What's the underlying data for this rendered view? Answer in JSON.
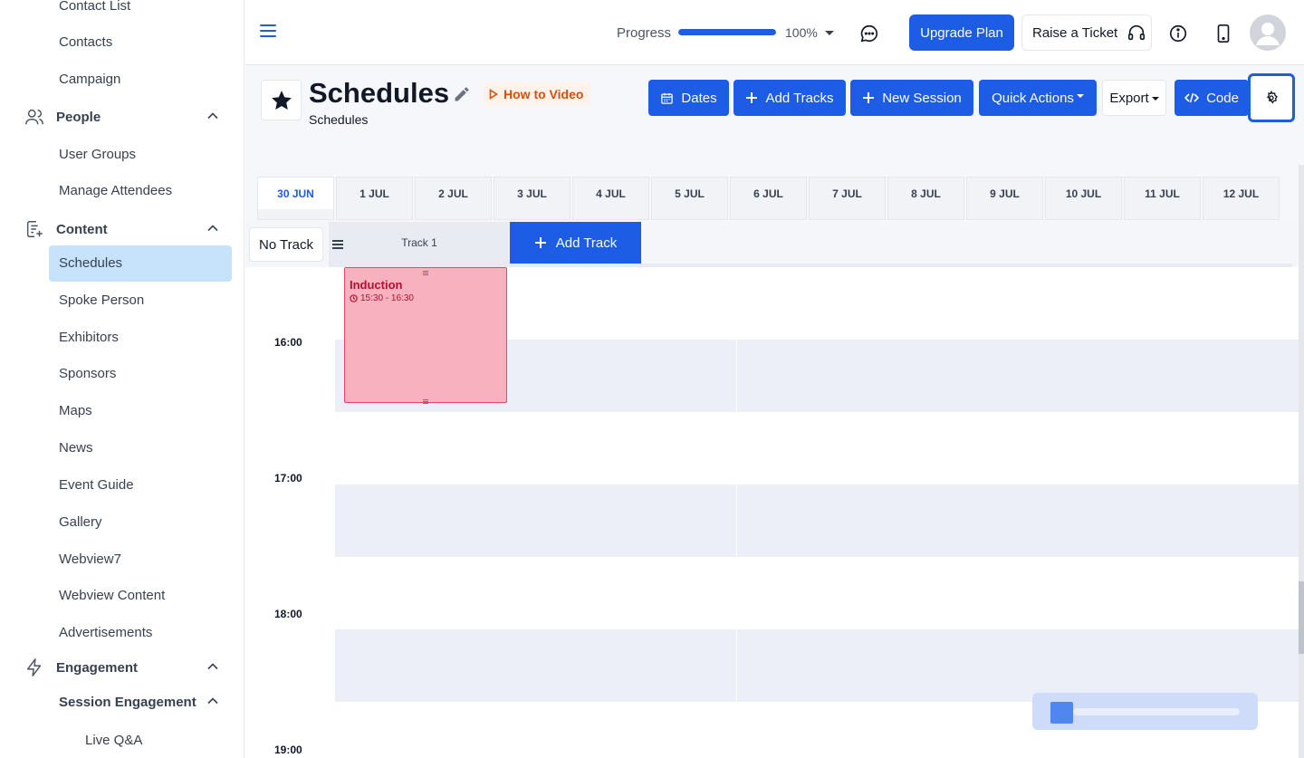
{
  "sidebar": {
    "items_top": [
      "Contact List",
      "Contacts",
      "Campaign"
    ],
    "people": {
      "label": "People",
      "items": [
        "User Groups",
        "Manage Attendees"
      ]
    },
    "content": {
      "label": "Content",
      "items": [
        "Schedules",
        "Spoke Person",
        "Exhibitors",
        "Sponsors",
        "Maps",
        "News",
        "Event Guide",
        "Gallery",
        "Webview7",
        "Webview Content",
        "Advertisements"
      ]
    },
    "engagement": {
      "label": "Engagement",
      "sub_label": "Session Engagement",
      "sub_items": [
        "Live Q&A"
      ]
    }
  },
  "header": {
    "progress_label": "Progress",
    "progress_value": 100,
    "progress_text": "100%",
    "upgrade_label": "Upgrade Plan",
    "ticket_label": "Raise a Ticket"
  },
  "page": {
    "title": "Schedules",
    "subtitle": "Schedules",
    "how_to": "How to Video"
  },
  "toolbar": {
    "dates": "Dates",
    "add_tracks": "Add Tracks",
    "new_session": "New Session",
    "quick_actions": "Quick Actions",
    "export": "Export",
    "code": "Code"
  },
  "dates": [
    "30 JUN",
    "1 JUL",
    "2 JUL",
    "3 JUL",
    "4 JUL",
    "5 JUL",
    "6 JUL",
    "7 JUL",
    "8 JUL",
    "9 JUL",
    "10 JUL",
    "11 JUL",
    "12 JUL"
  ],
  "tracks": {
    "no_track": "No Track",
    "track1": "Track 1",
    "add_track": "Add Track"
  },
  "times": [
    "16:00",
    "17:00",
    "18:00",
    "19:00"
  ],
  "session": {
    "title": "Induction",
    "time": "15:30 - 16:30"
  },
  "colors": {
    "primary": "#1d5ce5",
    "active_nav": "#c7e3fb",
    "session_bg": "#f8b1bf",
    "session_text": "#b50f2e",
    "howto_text": "#dc4c0c"
  }
}
